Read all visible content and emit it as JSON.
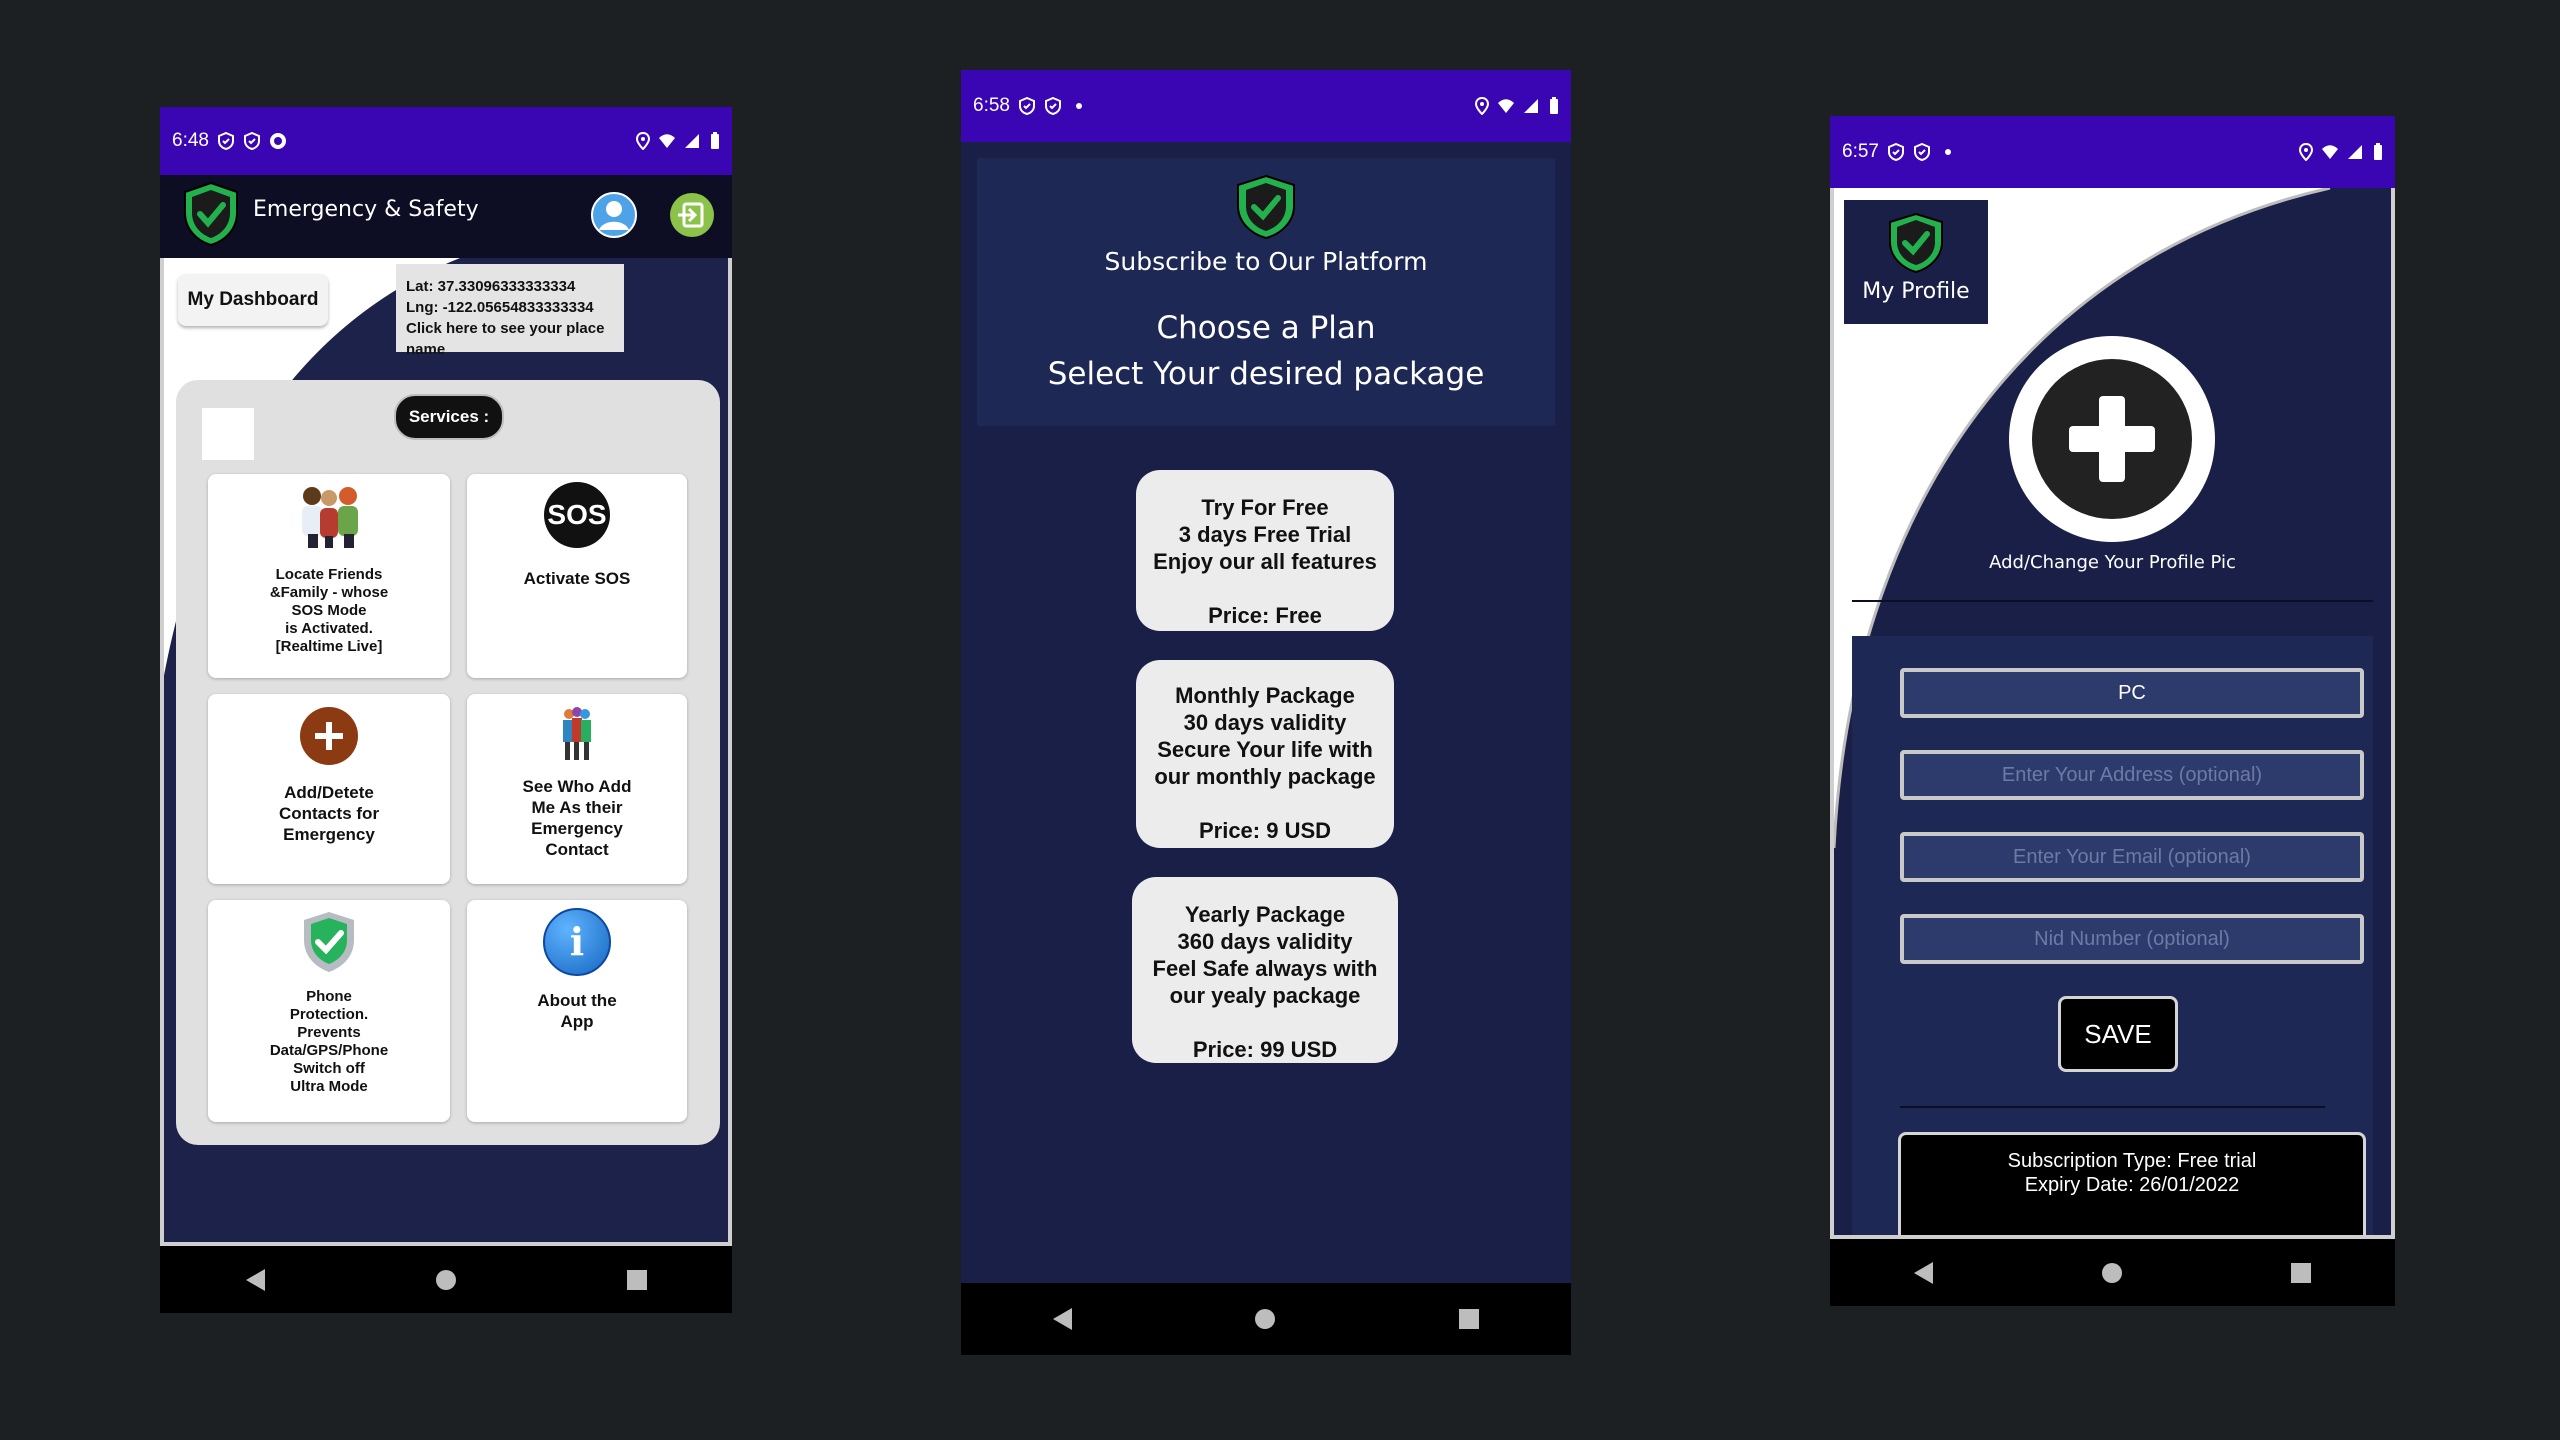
{
  "phone1": {
    "status": {
      "time": "6:48"
    },
    "app_title": "Emergency & Safety",
    "dashboard_label": "My Dashboard",
    "location": {
      "lat": "Lat: 37.33096333333334",
      "lng": "Lng: -122.05654833333334",
      "hint": "Click here to see your place name"
    },
    "services_label": "Services :",
    "tiles": [
      {
        "icon": "family-icon",
        "lines": [
          "Locate Friends",
          "&Family - whose",
          "SOS Mode",
          "is Activated.",
          "[Realtime Live]"
        ]
      },
      {
        "icon": "sos-icon",
        "badge": "SOS",
        "lines": [
          "Activate SOS"
        ]
      },
      {
        "icon": "add-contact-icon",
        "lines": [
          "Add/Detete",
          "Contacts for",
          "Emergency"
        ]
      },
      {
        "icon": "people-group-icon",
        "lines": [
          "See Who Add",
          "Me As their",
          "Emergency",
          "Contact"
        ]
      },
      {
        "icon": "shield-check-icon",
        "lines": [
          "Phone",
          "Protection.",
          "Prevents",
          "Data/GPS/Phone",
          "Switch off",
          "Ultra Mode"
        ]
      },
      {
        "icon": "info-icon",
        "badge": "i",
        "lines": [
          "About the",
          "App"
        ]
      }
    ]
  },
  "phone2": {
    "status": {
      "time": "6:58"
    },
    "subscribe_title": "Subscribe to Our Platform",
    "choose_plan": "Choose a Plan",
    "select_package": "Select Your desired package",
    "plans": [
      {
        "lines": [
          "Try For Free",
          "3 days Free Trial",
          "Enjoy our all features"
        ],
        "price": "Price: Free"
      },
      {
        "lines": [
          "Monthly Package",
          "30 days validity",
          "Secure Your life with",
          "our monthly package"
        ],
        "price": "Price: 9 USD"
      },
      {
        "lines": [
          "Yearly Package",
          "360 days validity",
          "Feel Safe always with",
          "our yealy package"
        ],
        "price": "Price: 99 USD"
      }
    ]
  },
  "phone3": {
    "status": {
      "time": "6:57"
    },
    "profile_title": "My Profile",
    "add_pic_label": "Add/Change Your Profile Pic",
    "name_value": "PC",
    "address_placeholder": "Enter Your Address (optional)",
    "email_placeholder": "Enter Your Email (optional)",
    "nid_placeholder": "Nid Number (optional)",
    "save_label": "SAVE",
    "subscription_type": "Subscription Type: Free trial",
    "expiry_date": "Expiry Date: 26/01/2022"
  },
  "colors": {
    "status_bar": "#3a06b3",
    "navy": "#1a1f48",
    "shield_green": "#2db84d",
    "field_bg": "#2d3a6c"
  }
}
